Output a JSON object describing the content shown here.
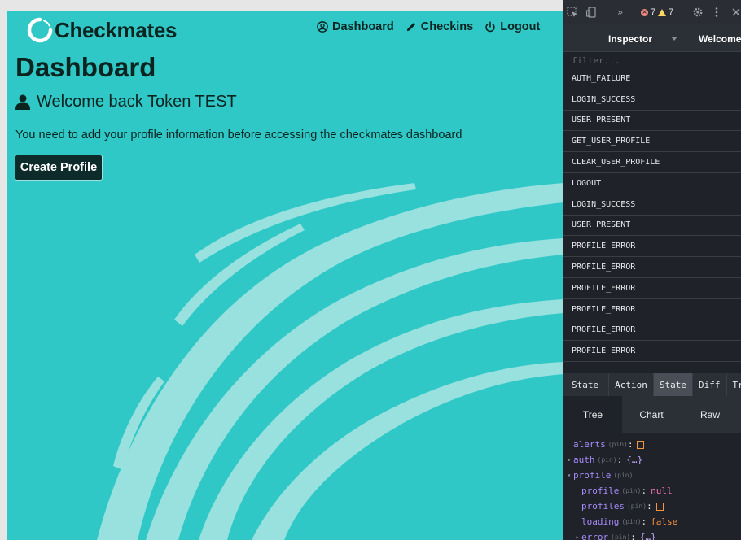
{
  "app": {
    "brand": "Checkmates",
    "nav": [
      {
        "label": "Dashboard",
        "icon": "user-circle-icon"
      },
      {
        "label": "Checkins",
        "icon": "pencil-icon"
      },
      {
        "label": "Logout",
        "icon": "power-icon"
      }
    ],
    "page_title": "Dashboard",
    "welcome": "Welcome back Token TEST",
    "notice": "You need to add your profile information before accessing the checkmates dashboard",
    "create_profile_label": "Create Profile"
  },
  "devtools": {
    "errors": "7",
    "warnings": "7",
    "more_tools": "»",
    "panel_selector": "Inspector",
    "instance": "Welcome t",
    "filter_placeholder": "filter...",
    "actions": [
      "AUTH_FAILURE",
      "LOGIN_SUCCESS",
      "USER_PRESENT",
      "GET_USER_PROFILE",
      "CLEAR_USER_PROFILE",
      "LOGOUT",
      "LOGIN_SUCCESS",
      "USER_PRESENT",
      "PROFILE_ERROR",
      "PROFILE_ERROR",
      "PROFILE_ERROR",
      "PROFILE_ERROR",
      "PROFILE_ERROR",
      "PROFILE_ERROR"
    ],
    "monitor_label": "State",
    "monitor_tabs": [
      "Action",
      "State",
      "Diff",
      "Tr"
    ],
    "active_monitor_tab": "State",
    "view_tabs": [
      "Tree",
      "Chart",
      "Raw"
    ],
    "active_view_tab": "Tree",
    "pin_label": "(pin)",
    "tree": {
      "alerts": {
        "key": "alerts",
        "value": "[]"
      },
      "auth": {
        "key": "auth",
        "value": "{…}"
      },
      "profile": {
        "key": "profile"
      },
      "profile_profile": {
        "key": "profile",
        "value": "null"
      },
      "profile_profiles": {
        "key": "profiles",
        "value": "[]"
      },
      "profile_loading": {
        "key": "loading",
        "value": "false"
      },
      "profile_error": {
        "key": "error",
        "value": "{…}"
      }
    }
  },
  "colors": {
    "app_background": "#30c8c6",
    "swirl": "#9ee3e1",
    "text_dark": "#0b2420",
    "button_bg": "#0d2b2a",
    "devtools_bg": "#1f2228"
  }
}
